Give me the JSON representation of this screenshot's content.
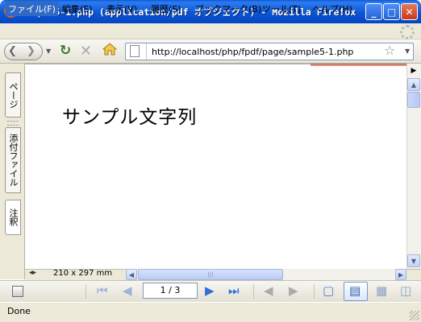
{
  "window": {
    "title": "sample5-1.php (application/pdf オブジェクト) - Mozilla Firefox",
    "minimize_icon": "minimize-icon",
    "maximize_icon": "maximize-icon",
    "close_icon": "close-icon"
  },
  "menu": [
    "ファイル(F)",
    "編集(E)",
    "表示(V)",
    "履歴(S)",
    "ブックマーク(B)",
    "ツール(T)",
    "ヘルプ(H)"
  ],
  "nav": {
    "url": "http://localhost/php/fpdf/page/sample5-1.php",
    "icons": [
      "back-icon",
      "forward-icon",
      "reload-icon",
      "stop-icon",
      "home-icon",
      "star-icon"
    ]
  },
  "side_tabs": {
    "pages": "ページ",
    "attachments": "添付ファイル",
    "notes": "注釈"
  },
  "document": {
    "text": "サンプル文字列"
  },
  "viewer": {
    "page_size": "210 x 297 mm",
    "page_indicator": "1 / 3"
  },
  "status": {
    "text": "Done"
  },
  "colors": {
    "titlebar": "#0b56d4",
    "menu_highlight": "#316ac5",
    "chrome": "#ece9d8"
  }
}
